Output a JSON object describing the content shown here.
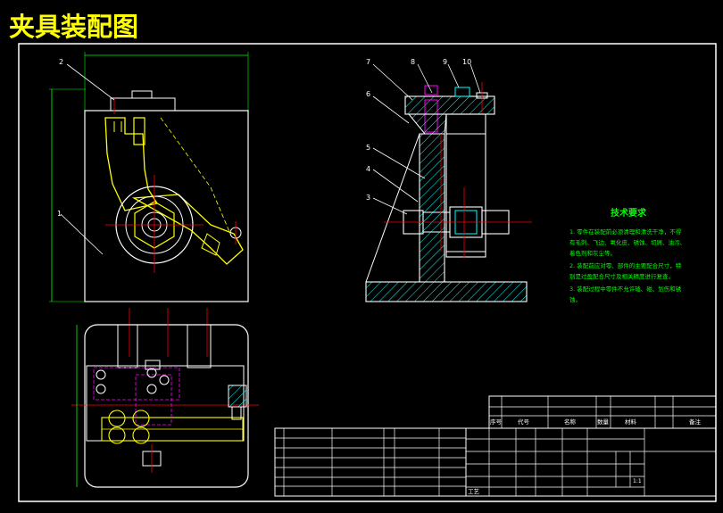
{
  "title": "夹具装配图",
  "tech": {
    "heading": "技术要求",
    "lines": [
      "1. 零件在装配前必须清理和清洗干净，不得",
      "有毛刺、飞边、氧化皮、锈蚀、切屑、油污、",
      "着色剂和灰尘等。",
      "2. 装配前应对零、部件的主要配合尺寸，特",
      "别是过盈配合尺寸及相关精度进行复查。",
      "3. 装配过程中零件不允许磕、碰、划伤和锈",
      "蚀。"
    ]
  },
  "balloons": {
    "front_2": "2",
    "front_1": "1",
    "side_7": "7",
    "side_8": "8",
    "side_9": "9",
    "side_10": "10",
    "side_6": "6",
    "side_5": "5",
    "side_4": "4",
    "side_3": "3"
  },
  "title_block": {
    "hdr_seq": "序号",
    "hdr_code": "代号",
    "hdr_name": "名称",
    "hdr_qty": "数量",
    "hdr_material": "材料",
    "hdr_remark": "备注",
    "craft": "工艺",
    "scale": "1:1"
  },
  "colors": {
    "frame": "#ffffff",
    "title": "#ffff00",
    "tech": "#00ff00",
    "part": "#ffff00",
    "hatch": "#00ffff",
    "center": "#ff0000",
    "hidden": "#ff00ff",
    "dim": "#00ff00"
  }
}
